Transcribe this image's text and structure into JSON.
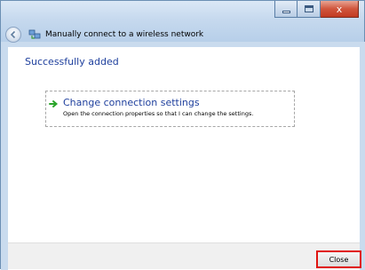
{
  "window": {
    "title": "Manually connect to a wireless network",
    "caption_buttons": {
      "minimize": "minimize",
      "maximize": "maximize",
      "close": "x"
    }
  },
  "main": {
    "heading": "Successfully added",
    "link": {
      "title": "Change connection settings",
      "description": "Open the connection properties so that I can change the settings."
    }
  },
  "footer": {
    "close_label": "Close"
  },
  "colors": {
    "accent_text": "#1e3f9d",
    "highlight_border": "#e0140f",
    "close_button_red": "#c23b22"
  },
  "icons": [
    "back-arrow-icon",
    "wireless-network-icon",
    "green-arrow-icon"
  ]
}
